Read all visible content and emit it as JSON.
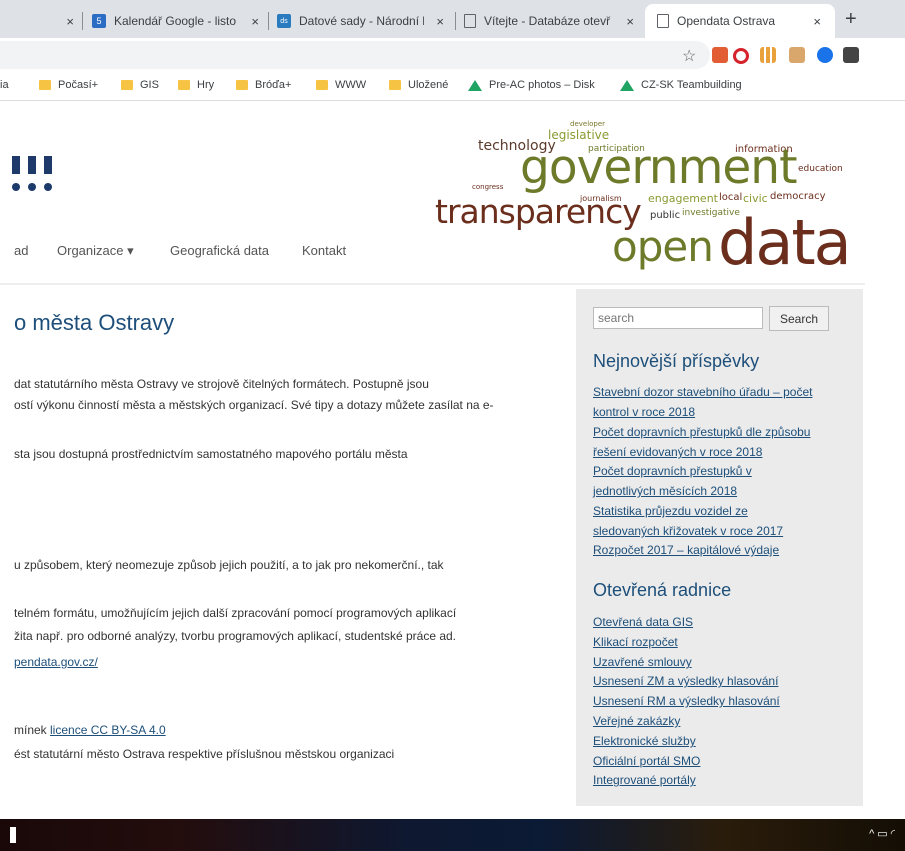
{
  "browser": {
    "tabs": [
      {
        "title": "",
        "active": false
      },
      {
        "title": "Kalendář Google - listo",
        "active": false,
        "favicon": "calendar-icon"
      },
      {
        "title": "Datové sady - Národní k",
        "active": false,
        "favicon": "datasets-icon"
      },
      {
        "title": "Vítejte - Databáze otevř",
        "active": false,
        "favicon": "page-icon"
      },
      {
        "title": "Opendata Ostrava",
        "active": true,
        "favicon": "page-icon"
      }
    ],
    "new_tab": "+",
    "close_glyph": "×",
    "bookmarks": [
      {
        "label": "ia",
        "type": "text"
      },
      {
        "label": "Počasí+",
        "type": "folder"
      },
      {
        "label": "GIS",
        "type": "folder"
      },
      {
        "label": "Hry",
        "type": "folder"
      },
      {
        "label": "Bróďa+",
        "type": "folder"
      },
      {
        "label": "WWW",
        "type": "folder"
      },
      {
        "label": "Uložené",
        "type": "folder"
      },
      {
        "label": "Pre-AC photos – Disk",
        "type": "drive"
      },
      {
        "label": "CZ-SK Teambuilding",
        "type": "drive"
      }
    ]
  },
  "header": {
    "logo_marks": "!!!",
    "wordcloud": {
      "government": "government",
      "transparency": "transparency",
      "open": "open",
      "data": "data",
      "technology": "technology",
      "legislative": "legislative",
      "participation": "participation",
      "information": "information",
      "engagement": "engagement",
      "civic": "civic",
      "democracy": "democracy",
      "public": "public",
      "investigative": "investigative",
      "journalism": "journalism",
      "local": "local",
      "education": "education",
      "developer": "developer",
      "congress": "congress"
    }
  },
  "nav": {
    "items": [
      "ad",
      "Organizace ▾",
      "Geografická data",
      "Kontakt"
    ]
  },
  "main": {
    "title": "o města Ostravy",
    "paragraphs": [
      "dat statutárního města Ostravy ve strojově čitelných formátech. Postupně jsou",
      "ostí výkonu činností města a městských organizací. Své tipy a dotazy můžete zasílat na e-",
      "sta jsou dostupná prostřednictvím samostatného mapového portálu města",
      "u způsobem, který neomezuje způsob jejich použití, a to jak pro nekomerční., tak",
      "telném formátu, umožňujícím jejich další zpracování pomocí programových aplikací",
      "žita např. pro odborné analýzy, tvorbu programových aplikací, studentské práce ad."
    ],
    "link_opendata": "pendata.gov.cz/",
    "licence_prefix": "mínek ",
    "licence_link": "licence CC BY-SA 4.0",
    "attribution": "ést statutární město Ostrava respektive příslušnou městskou organizaci"
  },
  "sidebar": {
    "search_placeholder": "search",
    "search_button": "Search",
    "recent_heading": "Nejnovější příspěvky",
    "recent_posts": [
      "Stavební dozor stavebního úřadu – počet",
      "kontrol v roce 2018",
      "Počet dopravních přestupků dle způsobu",
      "řešení evidovaných v roce 2018",
      "Počet dopravních přestupků v",
      "jednotlivých měsících 2018",
      "Statistika průjezdu vozidel ze",
      "sledovaných křižovatek v roce 2017",
      "Rozpočet 2017 – kapitálové výdaje"
    ],
    "open_heading": "Otevřená radnice",
    "open_links": [
      "Otevřená data GIS",
      "Klikací rozpočet",
      "Uzavřené smlouvy",
      "Usnesení ZM a výsledky hlasování",
      "Usnesení RM a výsledky hlasování",
      "Veřejné zakázky",
      "Elektronické služby",
      "Oficiální portál SMO",
      "Integrované portály"
    ]
  },
  "taskbar": {
    "tray": "^ ▭ ◜"
  },
  "colors": {
    "link": "#1d4f7a",
    "logo": "#1d3a6b",
    "wordcloud_brown": "#6b2e1c",
    "wordcloud_olive": "#6d7a2a",
    "sidebar_bg": "#ebebeb"
  }
}
